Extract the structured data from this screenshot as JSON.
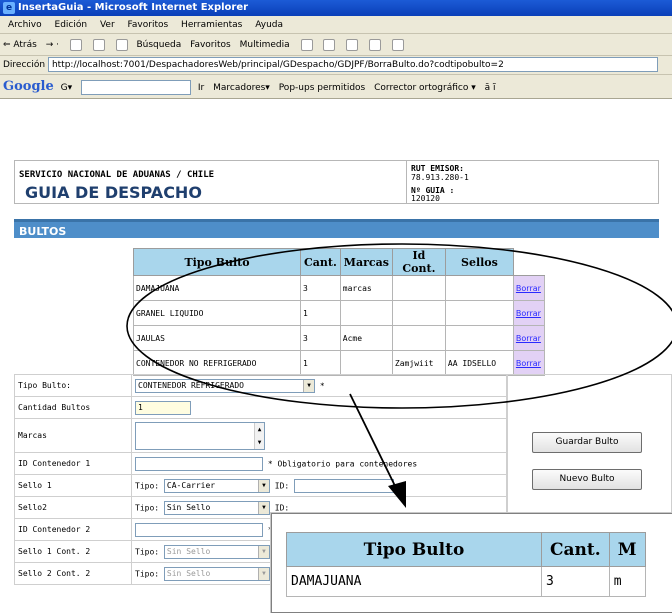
{
  "window": {
    "title": "InsertaGuia - Microsoft Internet Explorer"
  },
  "menu": [
    "Archivo",
    "Edición",
    "Ver",
    "Favoritos",
    "Herramientas",
    "Ayuda"
  ],
  "toolbar": {
    "back": "⇐ Atrás",
    "search": "Búsqueda",
    "favorites": "Favoritos",
    "multimedia": "Multimedia"
  },
  "address": {
    "label": "Dirección",
    "url": "http://localhost:7001/DespachadoresWeb/principal/GDespacho/GDJPF/BorraBulto.do?codtipobulto=2"
  },
  "googlebar": {
    "logo": "Google",
    "g_menu": "G▾",
    "go": "Ir",
    "bookmarks": "Marcadores▾",
    "popups": "Pop-ups permitidos",
    "spell": "Corrector ortográfico ▾",
    "translate": "ā ĩ"
  },
  "header": {
    "org": "SERVICIO NACIONAL DE ADUANAS / CHILE",
    "title": "GUIA DE DESPACHO",
    "rut_label": "RUT EMISOR:",
    "rut_value": "78.913.280-1",
    "guia_label": "Nº GUIA  :",
    "guia_value": "120120"
  },
  "section": {
    "title": "BULTOS"
  },
  "table": {
    "headers": [
      "Tipo Bulto",
      "Cant.",
      "Marcas",
      "Id Cont.",
      "Sellos"
    ],
    "rows": [
      {
        "tipo": "DAMAJUANA",
        "cant": "3",
        "marcas": "marcas",
        "idcont": "",
        "sellos": "",
        "action": "Borrar"
      },
      {
        "tipo": "GRANEL LIQUIDO",
        "cant": "1",
        "marcas": "",
        "idcont": "",
        "sellos": "",
        "action": "Borrar"
      },
      {
        "tipo": "JAULAS",
        "cant": "3",
        "marcas": "Acme",
        "idcont": "",
        "sellos": "",
        "action": "Borrar"
      },
      {
        "tipo": "CONTENEDOR NO REFRIGERADO",
        "cant": "1",
        "marcas": "",
        "idcont": "Zamjwiit",
        "sellos": "AA IDSELLO",
        "action": "Borrar"
      }
    ]
  },
  "form": {
    "tipo_bulto_label": "Tipo Bulto:",
    "tipo_bulto_value": "CONTENEDOR REFRIGERADO",
    "required_mark": "*",
    "cantidad_label": "Cantidad Bultos",
    "cantidad_value": "1",
    "marcas_label": "Marcas",
    "idcont1_label": "ID Contenedor 1",
    "idcont1_note": "* Obligatorio para contenedores",
    "sello1_label": "Sello 1",
    "sello1_tipo_label": "Tipo:",
    "sello1_tipo_value": "CA-Carrier",
    "sello1_id_label": "ID:",
    "sello2_label": "Sello2",
    "sello2_tipo_label": "Tipo:",
    "sello2_tipo_value": "Sin Sello",
    "sello2_id_label": "ID:",
    "idcont2_label": "ID Contenedor 2",
    "idcont2_note": "* O",
    "sello1c2_label": "Sello 1 Cont. 2",
    "sello1c2_tipo_label": "Tipo:",
    "sello1c2_tipo_value": "Sin Sello",
    "sello1c2_id_label": "I",
    "sello2c2_label": "Sello 2 Cont. 2",
    "sello2c2_tipo_label": "Tipo:",
    "sello2c2_tipo_value": "Sin Sello",
    "sello2c2_id_label": "I"
  },
  "buttons": {
    "guardar": "Guardar Bulto",
    "nuevo": "Nuevo Bulto"
  },
  "zoom": {
    "headers": [
      "Tipo Bulto",
      "Cant.",
      "M"
    ],
    "row": {
      "tipo": "DAMAJUANA",
      "cant": "3",
      "marcas": "m"
    }
  },
  "colors": {
    "section_bar": "#4e8ec9",
    "table_header": "#a9d6ec",
    "borrar_cell": "#e2d1f5",
    "title_text": "#1f3f6e"
  }
}
